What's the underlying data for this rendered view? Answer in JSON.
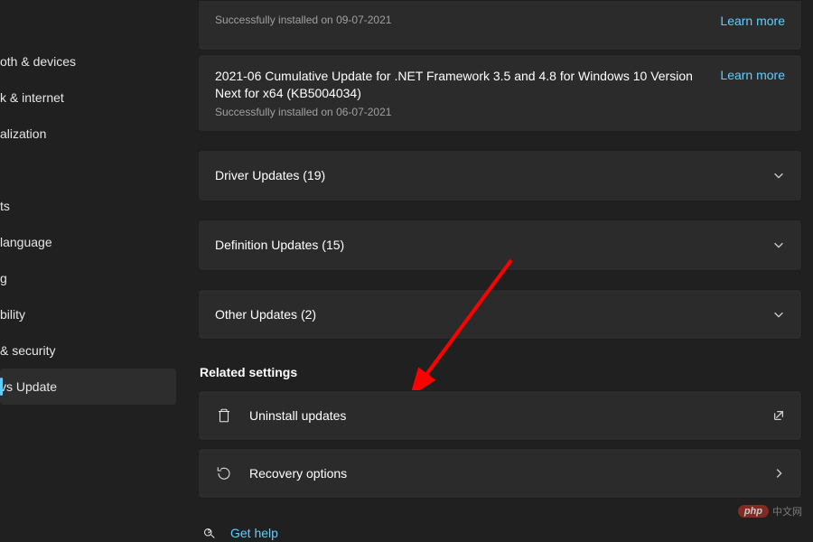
{
  "sidebar": {
    "items": [
      {
        "label": "oth & devices"
      },
      {
        "label": "k & internet"
      },
      {
        "label": "alization"
      },
      {
        "label": "ts"
      },
      {
        "label": "language"
      },
      {
        "label": "g"
      },
      {
        "label": "bility"
      },
      {
        "label": "& security"
      },
      {
        "label": "vs Update"
      }
    ]
  },
  "updates": {
    "prior_status": "Successfully installed on 09-07-2021",
    "prior_link": "Learn more",
    "item": {
      "title": "2021-06 Cumulative Update for .NET Framework 3.5 and 4.8 for Windows 10 Version Next for x64 (KB5004034)",
      "status": "Successfully installed on 06-07-2021",
      "link": "Learn more"
    },
    "groups": [
      {
        "label": "Driver Updates (19)"
      },
      {
        "label": "Definition Updates (15)"
      },
      {
        "label": "Other Updates (2)"
      }
    ]
  },
  "related": {
    "heading": "Related settings",
    "uninstall": "Uninstall updates",
    "recovery": "Recovery options"
  },
  "help": {
    "label": "Get help"
  },
  "watermark": {
    "badge": "php",
    "text": "中文网"
  }
}
